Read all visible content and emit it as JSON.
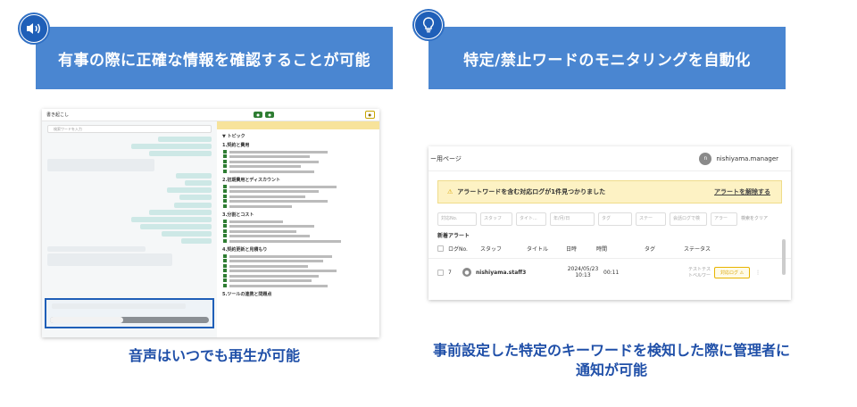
{
  "features": [
    {
      "icon": "speaker-icon",
      "title": "有事の際に正確な情報を確認することが可能",
      "caption": "音声はいつでも再生が可能"
    },
    {
      "icon": "lightbulb-icon",
      "title": "特定/禁止ワードのモニタリングを自動化",
      "caption": "事前設定した特定のキーワードを検知した際に管理者に通知が可能"
    }
  ],
  "left_screenshot": {
    "title": "書き起こし",
    "search_placeholder": "検索ワードを入力",
    "topic_bar": "トピック",
    "playback_progress": 0.46,
    "topics": [
      "1.契約と費用",
      "2.初期費用とディスカウント",
      "3.分割とコスト",
      "4.契約更新と見積もり",
      "5.ツールの連携と問題点"
    ]
  },
  "right_screenshot": {
    "page_title": "ー用ページ",
    "user_avatar": "n",
    "user_name": "nishiyama.manager",
    "alert_text": "アラートワードを含む対応ログが1件見つかりました",
    "alert_link": "アラートを解除する",
    "filters": [
      "対応No.",
      "スタッフ",
      "タイト...",
      "年/月/日",
      "タグ",
      "ステー",
      "会話ログで検",
      "アラー",
      "検索をクリア"
    ],
    "section_title": "新着アラート",
    "columns": [
      "ログNo.",
      "スタッフ",
      "タイトル",
      "日時",
      "時間",
      "タグ",
      "ステータス"
    ],
    "row": {
      "log_no": "7",
      "staff": "nishiyama.staff3",
      "datetime": "2024/05/23 10:13",
      "duration": "00:11",
      "tag": "テストテス トベルワー",
      "action": "対応ログ ⚠"
    }
  }
}
